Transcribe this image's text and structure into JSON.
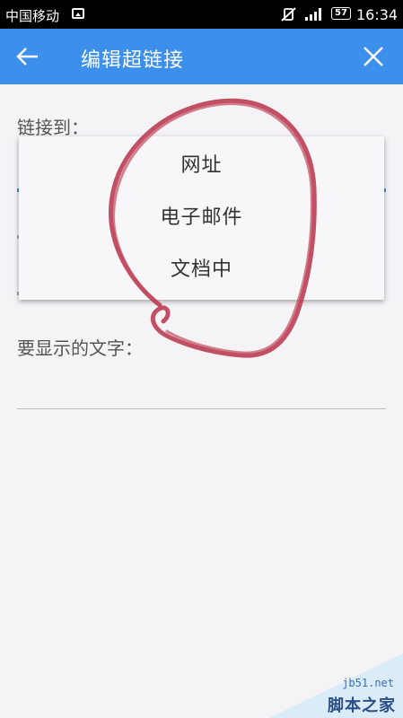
{
  "status_bar": {
    "carrier": "中国移动",
    "battery": "57",
    "time": "16:34"
  },
  "app_bar": {
    "title": "编辑超链接",
    "back_icon": "arrow-left-icon",
    "close_icon": "close-icon"
  },
  "form": {
    "link_to_label": "链接到：",
    "display_text_label": "要显示的文字："
  },
  "dropdown": {
    "options": [
      "网址",
      "电子邮件",
      "文档中"
    ]
  },
  "annotation": {
    "color": "#b8324a"
  },
  "watermark": {
    "url": "jb51.net",
    "name": "脚本之家"
  },
  "colors": {
    "accent": "#3d8fec",
    "status_bar": "#000000",
    "background": "#f4f3f6"
  }
}
